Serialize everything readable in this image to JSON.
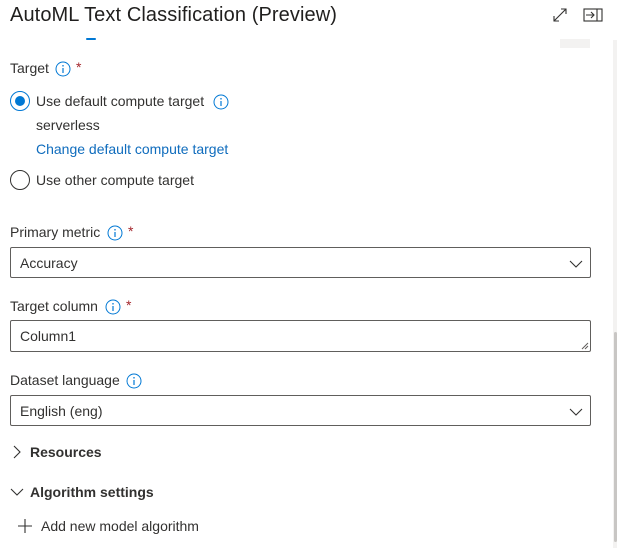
{
  "header": {
    "title": "AutoML Text Classification (Preview)",
    "icons": [
      "expand-icon",
      "dock-panel-icon"
    ]
  },
  "target": {
    "label": "Target",
    "required_mark": "*",
    "options": [
      {
        "label": "Use default compute target",
        "selected": true
      },
      {
        "label": "Use other compute target",
        "selected": false
      }
    ],
    "default_value": "serverless",
    "change_link": "Change default compute target"
  },
  "primary_metric": {
    "label": "Primary metric",
    "required_mark": "*",
    "value": "Accuracy"
  },
  "target_column": {
    "label": "Target column",
    "required_mark": "*",
    "value": "Column1"
  },
  "dataset_language": {
    "label": "Dataset language",
    "value": "English (eng)"
  },
  "sections": {
    "resources": "Resources",
    "algorithm_settings": "Algorithm settings"
  },
  "add_algorithm": {
    "label": "Add new model algorithm"
  },
  "colors": {
    "accent": "#0078d4",
    "link": "#0f6cbd",
    "required": "#a4262c",
    "text": "#323130"
  }
}
